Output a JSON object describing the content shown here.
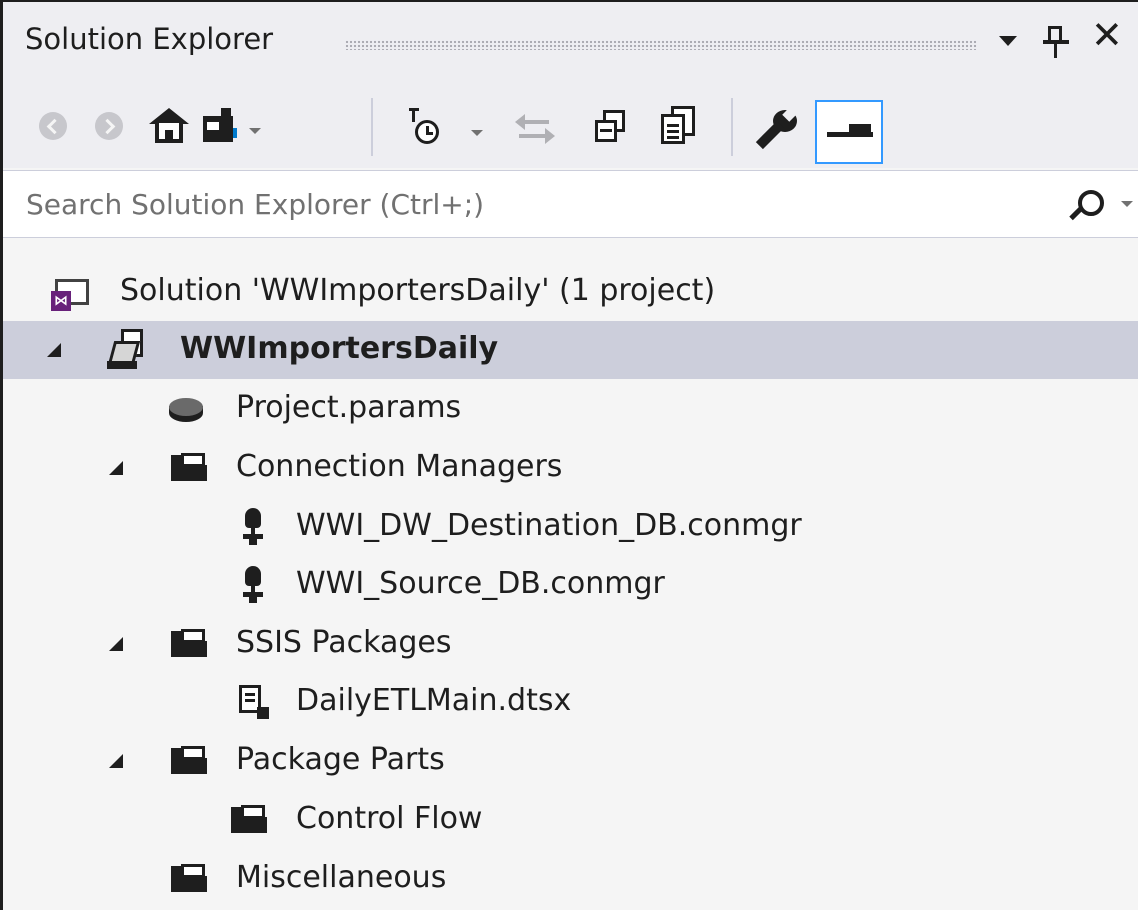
{
  "window": {
    "title": "Solution Explorer",
    "icons": [
      "dropdown-arrow-icon",
      "pin-icon",
      "close-icon"
    ]
  },
  "toolbar": {
    "icons": [
      "back-icon",
      "forward-icon",
      "home-icon",
      "switch-views-icon",
      "pending-changes-filter-icon",
      "sync-active-document-icon",
      "collapse-all-icon",
      "show-all-files-icon",
      "properties-icon",
      "preview-selected-items-icon"
    ],
    "selected": "preview-selected-items-icon"
  },
  "search": {
    "placeholder": "Search Solution Explorer (Ctrl+;)",
    "icon": "search-icon"
  },
  "tree": {
    "solution": "Solution 'WWImportersDaily' (1 project)",
    "project": "WWImportersDaily",
    "project_params": "Project.params",
    "connection_managers": {
      "label": "Connection Managers",
      "items": [
        "WWI_DW_Destination_DB.conmgr",
        "WWI_Source_DB.conmgr"
      ]
    },
    "ssis_packages": {
      "label": "SSIS Packages",
      "items": [
        "DailyETLMain.dtsx"
      ]
    },
    "package_parts": {
      "label": "Package Parts",
      "items": [
        "Control Flow"
      ]
    },
    "miscellaneous": "Miscellaneous"
  },
  "colors": {
    "selection": "#cccedb",
    "focus_border": "#3399ff",
    "panel": "#eeeef2",
    "vs_purple": "#68217a"
  }
}
